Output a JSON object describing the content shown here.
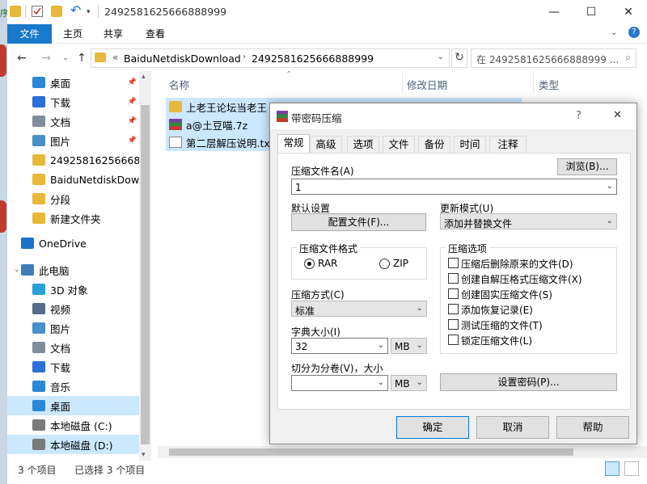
{
  "explorer": {
    "title_path": "2492581625666888999",
    "ribbon_tabs": [
      "文件",
      "主页",
      "共享",
      "查看"
    ],
    "address": {
      "separator": "«",
      "segments": [
        "BaiduNetdiskDownload",
        "2492581625666888999"
      ]
    },
    "search_placeholder": "在 2492581625666888999 ...",
    "nav_items": [
      {
        "label": "桌面",
        "icon": "desktop-icon",
        "pinned": true,
        "color": "#2b88d8"
      },
      {
        "label": "下载",
        "icon": "download-icon",
        "pinned": true,
        "color": "#2b6fd8"
      },
      {
        "label": "文档",
        "icon": "document-icon",
        "pinned": true,
        "color": "#7f8c9c"
      },
      {
        "label": "图片",
        "icon": "picture-icon",
        "pinned": true,
        "color": "#4a90c8"
      },
      {
        "label": "249258162566688",
        "icon": "folder-icon",
        "pinned": false,
        "color": "#e8b83a"
      },
      {
        "label": "BaiduNetdiskDown",
        "icon": "folder-icon",
        "pinned": false,
        "color": "#e8b83a"
      },
      {
        "label": "分段",
        "icon": "folder-icon",
        "pinned": false,
        "color": "#e8b83a"
      },
      {
        "label": "新建文件夹",
        "icon": "folder-icon",
        "pinned": false,
        "color": "#e8b83a"
      },
      {
        "label": "OneDrive",
        "icon": "cloud-icon",
        "pinned": false,
        "color": "#1a73c8"
      },
      {
        "label": "此电脑",
        "icon": "computer-icon",
        "pinned": false,
        "color": "#3c7fb8"
      },
      {
        "label": "3D 对象",
        "icon": "cube-icon",
        "pinned": false,
        "color": "#29a0d8"
      },
      {
        "label": "视频",
        "icon": "video-icon",
        "pinned": false,
        "color": "#556b8a"
      },
      {
        "label": "图片",
        "icon": "picture-icon",
        "pinned": false,
        "color": "#4a90c8"
      },
      {
        "label": "文档",
        "icon": "document-icon",
        "pinned": false,
        "color": "#7f8c9c"
      },
      {
        "label": "下载",
        "icon": "download-icon",
        "pinned": false,
        "color": "#2b6fd8"
      },
      {
        "label": "音乐",
        "icon": "music-icon",
        "pinned": false,
        "color": "#2b88d8"
      },
      {
        "label": "桌面",
        "icon": "desktop-icon",
        "pinned": false,
        "color": "#2b88d8"
      },
      {
        "label": "本地磁盘 (C:)",
        "icon": "drive-icon",
        "pinned": false,
        "color": "#7a7a7a"
      },
      {
        "label": "本地磁盘 (D:)",
        "icon": "drive-icon",
        "pinned": false,
        "color": "#7a7a7a"
      }
    ],
    "columns": [
      "名称",
      "修改日期",
      "类型"
    ],
    "files": [
      {
        "name": "上老王论坛当老王",
        "icon": "folder-icon"
      },
      {
        "name": "a@土豆喵.7z",
        "icon": "archive-icon"
      },
      {
        "name": "第二层解压说明.txt",
        "icon": "text-file-icon"
      }
    ],
    "status": {
      "count": "3 个项目",
      "selected": "已选择 3 个项目"
    }
  },
  "dialog": {
    "title": "带密码压缩",
    "help": "?",
    "close": "✕",
    "tabs": [
      "常规",
      "高级",
      "选项",
      "文件",
      "备份",
      "时间",
      "注释"
    ],
    "archive_name_label": "压缩文件名(A)",
    "browse_button": "浏览(B)...",
    "archive_name_value": "1",
    "default_settings_label": "默认设置",
    "profiles_button": "配置文件(F)...",
    "update_mode_label": "更新模式(U)",
    "update_mode_value": "添加并替换文件",
    "format_group": "压缩文件格式",
    "format_rar": "RAR",
    "format_zip": "ZIP",
    "method_label": "压缩方式(C)",
    "method_value": "标准",
    "dict_label": "字典大小(I)",
    "dict_value": "32",
    "dict_unit": "MB",
    "split_label": "切分为分卷(V)，大小",
    "split_value": "",
    "split_unit": "MB",
    "options_group": "压缩选项",
    "options": [
      "压缩后删除原来的文件(D)",
      "创建自解压格式压缩文件(X)",
      "创建固实压缩文件(S)",
      "添加恢复记录(E)",
      "测试压缩的文件(T)",
      "锁定压缩文件(L)"
    ],
    "set_password_button": "设置密码(P)...",
    "ok_button": "确定",
    "cancel_button": "取消",
    "help_button": "帮助"
  }
}
